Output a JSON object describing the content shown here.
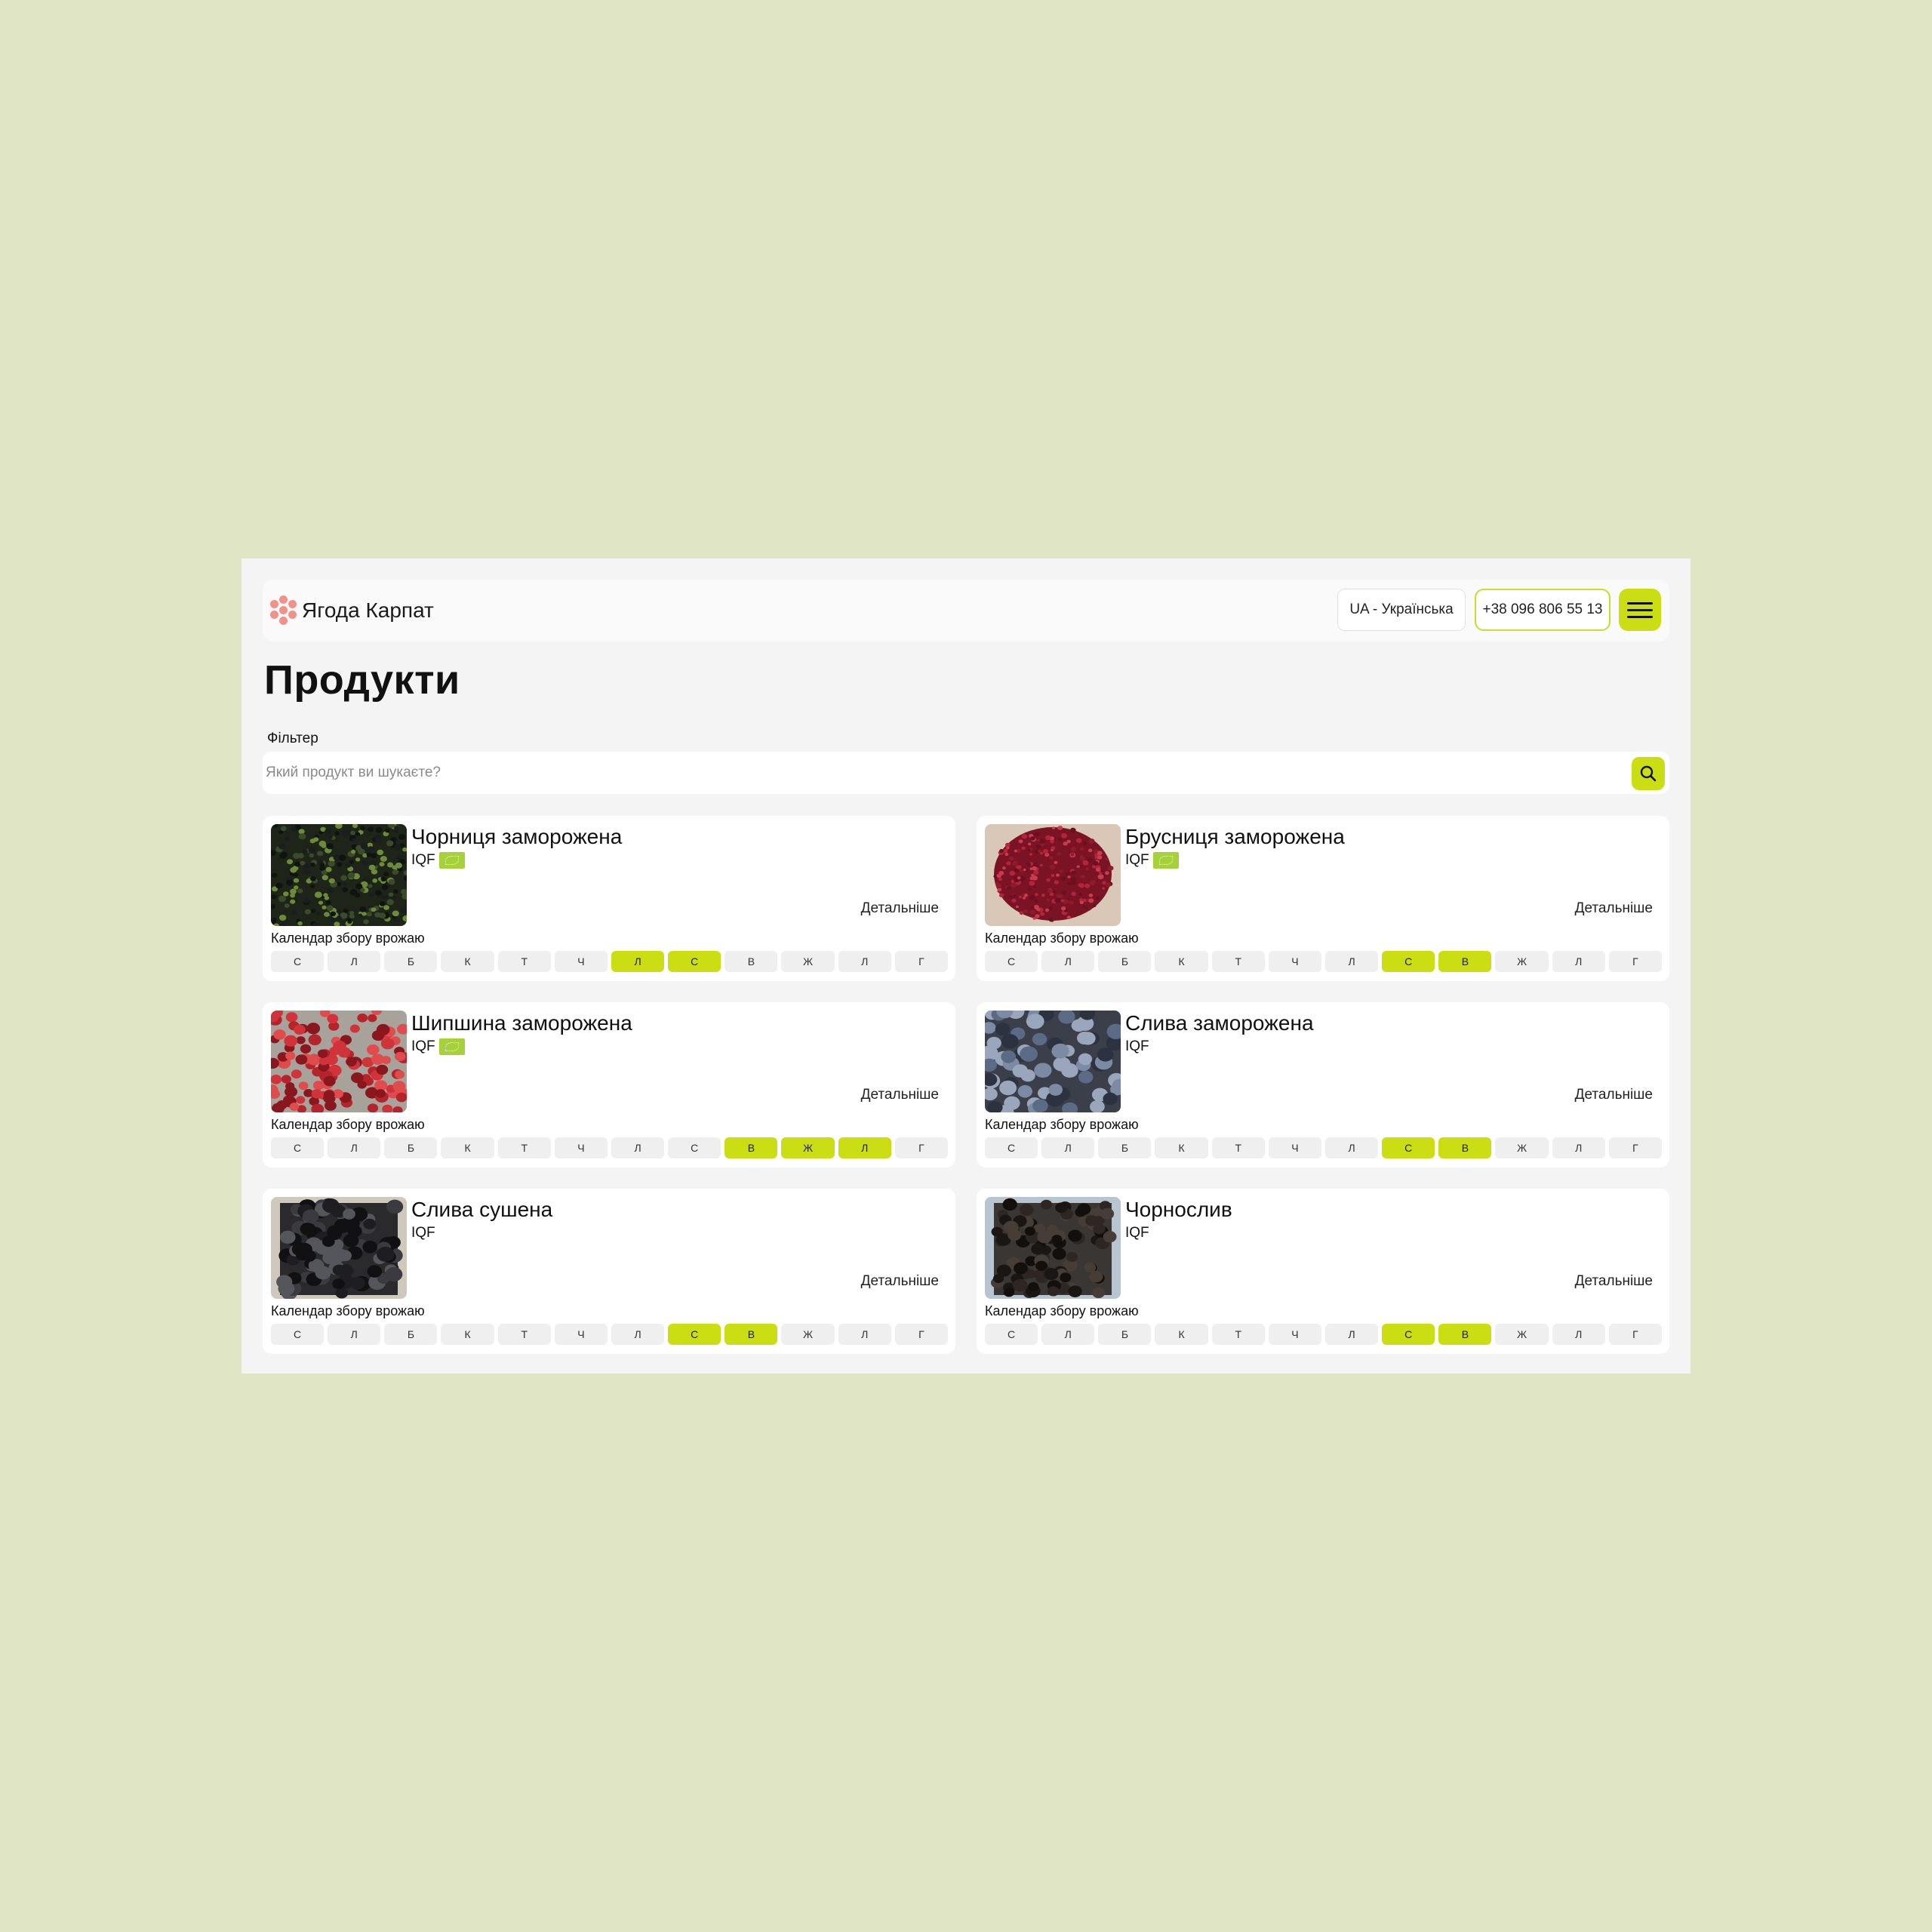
{
  "header": {
    "logo_text": "Ягода Карпат",
    "language": "UA - Українська",
    "phone": "+38 096 806 55 13"
  },
  "page_title": "Продукти",
  "filter": {
    "label": "Фільтер",
    "placeholder": "Який продукт ви шукаєте?",
    "value": ""
  },
  "colors": {
    "accent": "#cbde14",
    "background": "#e0e5c5",
    "logo": "#f0928a",
    "eco_badge": "#a7d13a"
  },
  "months": [
    "С",
    "Л",
    "Б",
    "К",
    "Т",
    "Ч",
    "Л",
    "С",
    "В",
    "Ж",
    "Л",
    "Г"
  ],
  "calendar_label": "Календар збору врожаю",
  "details_label": "Детальніше",
  "products": [
    {
      "name": "Чорниця заморожена",
      "tag": "IQF",
      "eco": true,
      "image": "blueberries",
      "active_months": [
        6,
        7
      ]
    },
    {
      "name": "Брусниця заморожена",
      "tag": "IQF",
      "eco": true,
      "image": "lingonberries",
      "active_months": [
        7,
        8
      ]
    },
    {
      "name": "Шипшина заморожена",
      "tag": "IQF",
      "eco": true,
      "image": "rosehips",
      "active_months": [
        8,
        9,
        10
      ]
    },
    {
      "name": "Слива заморожена",
      "tag": "IQF",
      "eco": false,
      "image": "frozen-plums",
      "active_months": [
        7,
        8
      ]
    },
    {
      "name": "Слива сушена",
      "tag": "IQF",
      "eco": false,
      "image": "dried-plums",
      "active_months": [
        7,
        8
      ]
    },
    {
      "name": "Чорнослив",
      "tag": "IQF",
      "eco": false,
      "image": "prunes",
      "active_months": [
        7,
        8
      ]
    }
  ]
}
